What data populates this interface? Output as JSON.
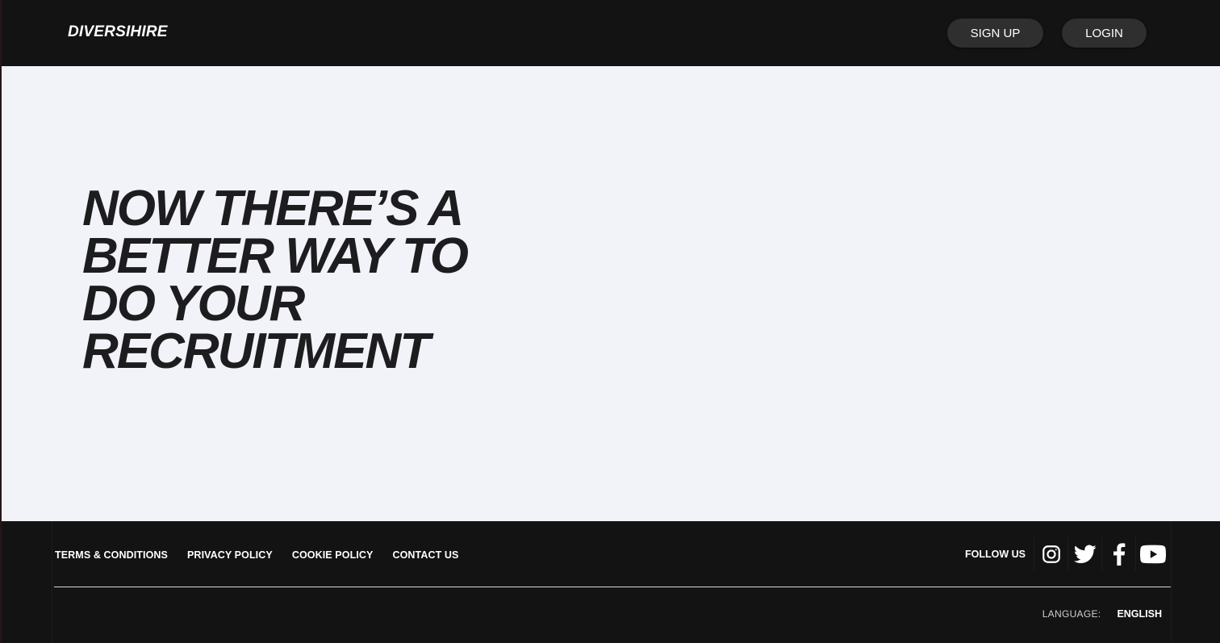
{
  "header": {
    "logo": "DIVERSIHIRE",
    "signup_label": "SIGN UP",
    "login_label": "LOGIN"
  },
  "hero": {
    "headline_lines": [
      "NOW THERE’S A",
      "BETTER WAY TO",
      "DO YOUR",
      "RECRUITMENT"
    ]
  },
  "footer": {
    "links": [
      "TERMS & CONDITIONS",
      "PRIVACY POLICY",
      "COOKIE POLICY",
      "CONTACT US"
    ],
    "follow_label": "FOLLOW US",
    "social_icons": [
      "instagram-icon",
      "twitter-icon",
      "facebook-icon",
      "youtube-icon"
    ],
    "language_label": "LANGUAGE:",
    "language_value": "ENGLISH"
  },
  "colors": {
    "header_bg": "#141314",
    "hero_bg": "#f2f3f9",
    "button_bg": "#2f2f30",
    "headline": "#1d1d1f"
  }
}
